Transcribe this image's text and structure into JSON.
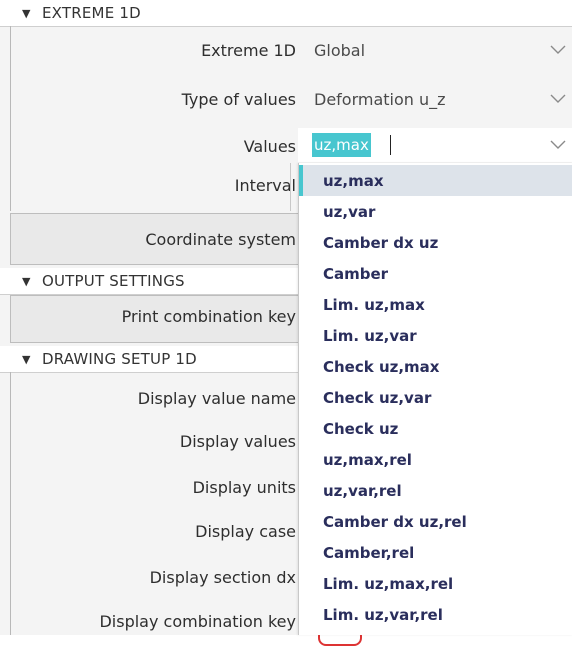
{
  "sections": {
    "extreme": "EXTREME 1D",
    "output": "OUTPUT SETTINGS",
    "drawing": "DRAWING SETUP 1D"
  },
  "properties": {
    "extreme_1d": {
      "label": "Extreme 1D",
      "value": "Global"
    },
    "type_of_values": {
      "label": "Type of values",
      "value": "Deformation u_z"
    },
    "values": {
      "label": "Values",
      "value": "uz,max"
    },
    "interval": {
      "label": "Interval"
    },
    "coordinate_system": {
      "label": "Coordinate system"
    },
    "print_combination_key": {
      "label": "Print combination key"
    },
    "display_value_name": {
      "label": "Display value name"
    },
    "display_values": {
      "label": "Display values"
    },
    "display_units": {
      "label": "Display units"
    },
    "display_case": {
      "label": "Display case"
    },
    "display_section_dx": {
      "label": "Display section dx"
    },
    "display_combination_key": {
      "label": "Display combination key"
    }
  },
  "dropdown": {
    "selected": "uz,max",
    "options": [
      "uz,max",
      "uz,var",
      "Camber dx uz",
      "Camber",
      "Lim. uz,max",
      "Lim. uz,var",
      "Check uz,max",
      "Check uz,var",
      "Check uz",
      "uz,max,rel",
      "uz,var,rel",
      "Camber dx uz,rel",
      "Camber,rel",
      "Lim. uz,max,rel",
      "Lim. uz,var,rel"
    ]
  },
  "icons": {
    "collapse": "triangle-down-icon",
    "dropdown": "chevron-down-icon"
  },
  "colors": {
    "selection": "#47c6cf",
    "option_text": "#2a2e5c",
    "selected_row_bg": "#dde3ea"
  }
}
